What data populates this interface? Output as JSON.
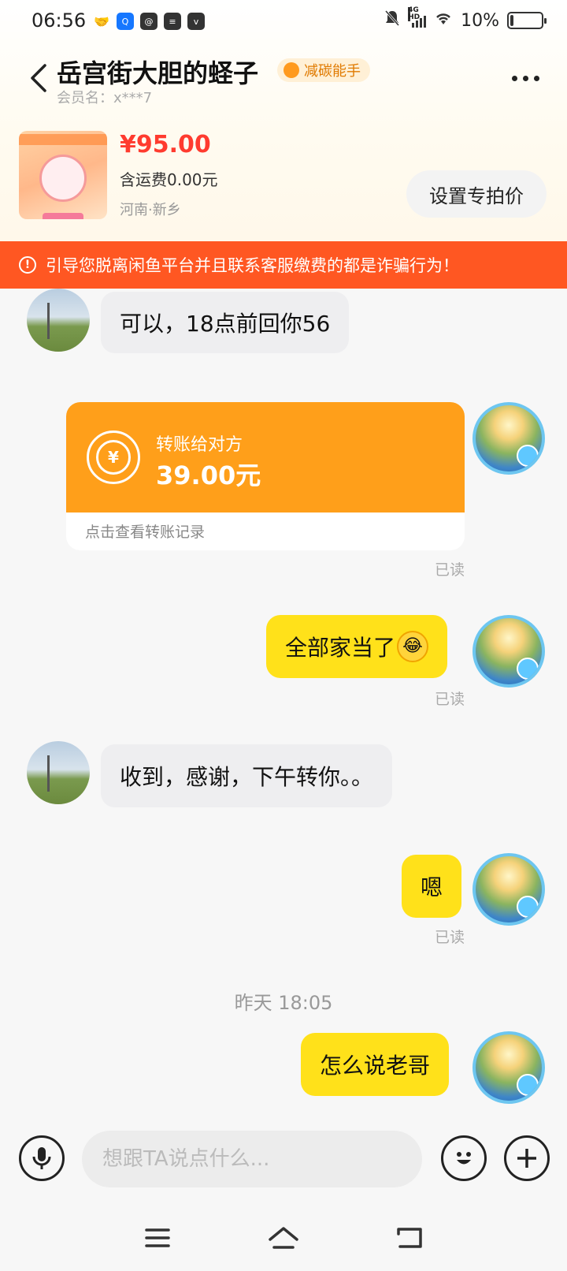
{
  "status_bar": {
    "time": "06:56",
    "network": "4G HD",
    "battery": "10%",
    "battery_level": 0.1,
    "left_icons": [
      "handshake-icon",
      "qq-icon",
      "browser-icon",
      "storage-icon",
      "vivo-icon"
    ]
  },
  "header": {
    "title": "岳宫街大胆的蛏子",
    "badge": "减碳能手",
    "subtitle": "会员名：x***7"
  },
  "product": {
    "price": "¥95.00",
    "shipping": "含运费0.00元",
    "location": "河南·新乡",
    "set_price_label": "设置专拍价"
  },
  "warning": {
    "text": "引导您脱离闲鱼平台并且联系客服缴费的都是诈骗行为！"
  },
  "messages": {
    "m1": "可以，18点前回你56",
    "transfer_label": "转账给对方",
    "transfer_amount": "39.00元",
    "transfer_link": "点击查看转账记录",
    "read": "已读",
    "m2": "全部家当了",
    "m3": "收到，感谢，下午转你。。",
    "m4": "嗯",
    "time_divider": "昨天 18:05",
    "m5": "怎么说老哥"
  },
  "input": {
    "placeholder": "想跟TA说点什么..."
  },
  "colors": {
    "accent_yellow": "#ffe11a",
    "transfer_orange": "#ff9f1a",
    "warning_red": "#ff5722",
    "price_red": "#ff3b2f"
  }
}
